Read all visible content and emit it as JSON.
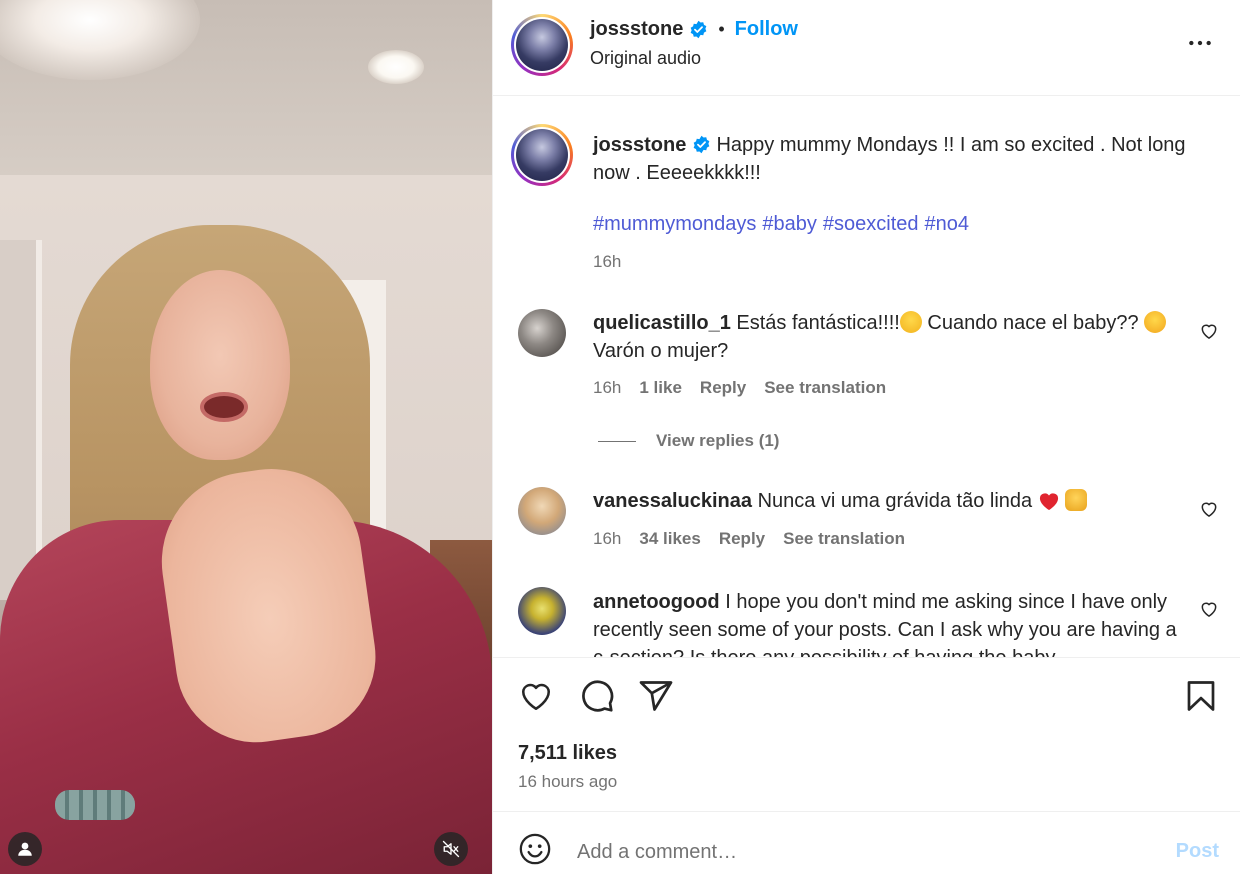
{
  "header": {
    "username": "jossstone",
    "follow_label": "Follow",
    "separator": "•",
    "audio": "Original audio"
  },
  "caption": {
    "username": "jossstone",
    "text": "Happy mummy Mondays !! I am so excited . Not long now . Eeeeekkkk!!!",
    "hashtags": [
      "#mummymondays",
      "#baby",
      "#soexcited",
      "#no4"
    ],
    "time": "16h"
  },
  "comments": [
    {
      "username": "quelicastillo_1",
      "text_a": "Estás fantástica!!!!",
      "text_b": "Cuando nace el baby??",
      "text_c": "Varón o mujer?",
      "time": "16h",
      "likes": "1 like",
      "reply": "Reply",
      "translate": "See translation",
      "view_replies": "View replies (1)"
    },
    {
      "username": "vanessaluckinaa",
      "text": "Nunca vi uma grávida tão linda",
      "time": "16h",
      "likes": "34 likes",
      "reply": "Reply",
      "translate": "See translation"
    },
    {
      "username": "annetoogood",
      "text": "I hope you don't mind me asking since I have only recently seen some of your posts. Can I ask why you are having a c-section? Is there any possibility of having the baby"
    }
  ],
  "stats": {
    "likes": "7,511 likes",
    "ago": "16 hours ago"
  },
  "add_comment": {
    "placeholder": "Add a comment…",
    "post_label": "Post"
  },
  "icons": {
    "verified": "verified-badge-icon",
    "more": "more-options-icon",
    "like": "heart-icon",
    "comment": "comment-icon",
    "share": "share-icon",
    "save": "bookmark-icon",
    "emoji": "smiley-icon",
    "tag": "tagged-user-icon",
    "mute": "muted-speaker-icon"
  },
  "colors": {
    "accent": "#0095f6",
    "hashtag": "#4f5bd5",
    "muted": "#737373",
    "post_disabled": "#b3dbff"
  }
}
